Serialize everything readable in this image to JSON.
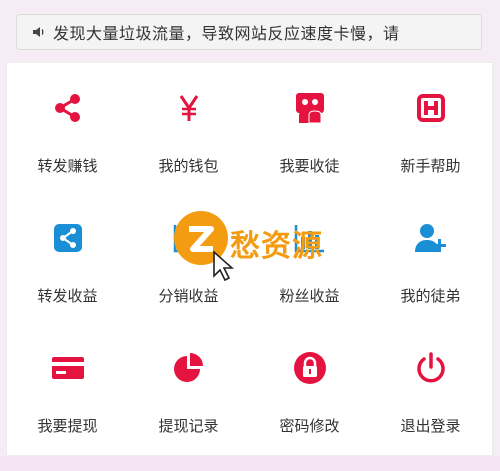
{
  "notice": {
    "icon": "speaker-icon",
    "text": "发现大量垃圾流量，导致网站反应速度卡慢，请"
  },
  "menu": [
    {
      "label": "转发赚钱",
      "icon": "share-icon"
    },
    {
      "label": "我的钱包",
      "icon": "yen-icon"
    },
    {
      "label": "我要收徒",
      "icon": "users-icon"
    },
    {
      "label": "新手帮助",
      "icon": "help-h-icon"
    },
    {
      "label": "转发收益",
      "icon": "share-box-icon"
    },
    {
      "label": "分销收益",
      "icon": "chart-icon"
    },
    {
      "label": "粉丝收益",
      "icon": "chart-icon"
    },
    {
      "label": "我的徒弟",
      "icon": "add-user-icon"
    },
    {
      "label": "我要提现",
      "icon": "card-icon"
    },
    {
      "label": "提现记录",
      "icon": "pie-chart-icon"
    },
    {
      "label": "密码修改",
      "icon": "lock-icon"
    },
    {
      "label": "退出登录",
      "icon": "power-icon"
    }
  ],
  "watermark": {
    "text": "愁资源"
  },
  "colors": {
    "red": "#e5133f",
    "blue": "#1a8fd6",
    "text": "#333333"
  }
}
